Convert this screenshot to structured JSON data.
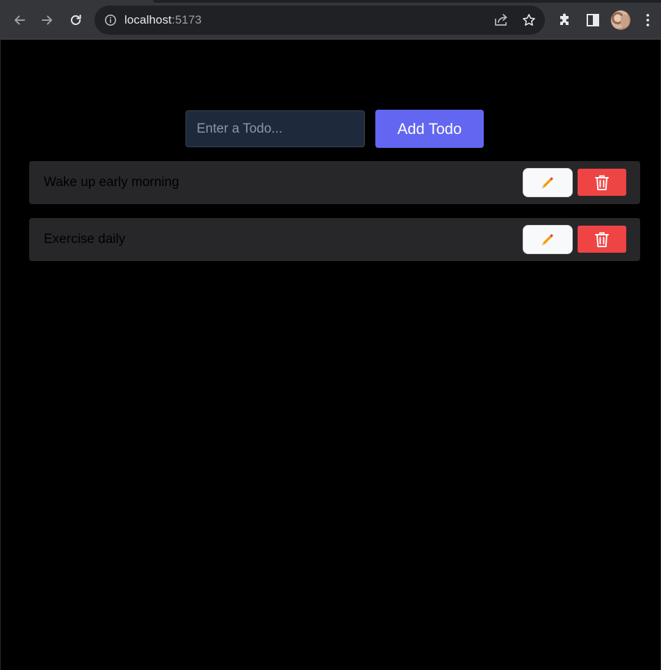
{
  "browser": {
    "url_host": "localhost",
    "url_port": ":5173",
    "icons": [
      "back-arrow-icon",
      "forward-arrow-icon",
      "reload-icon",
      "info-icon",
      "share-icon",
      "star-icon",
      "extensions-icon",
      "side-panel-icon",
      "avatar",
      "kebab-menu-icon"
    ]
  },
  "form": {
    "placeholder": "Enter a Todo...",
    "value": "",
    "add_label": "Add Todo"
  },
  "todos": [
    {
      "text": "Wake up early morning"
    },
    {
      "text": "Exercise daily"
    }
  ],
  "item_icons": {
    "edit": "pencil-icon",
    "delete": "trash-icon"
  },
  "colors": {
    "accent": "#6366f1",
    "delete": "#ef4444",
    "item_bg": "#27272a",
    "input_bg": "#1e293b",
    "page_bg": "#000000"
  }
}
